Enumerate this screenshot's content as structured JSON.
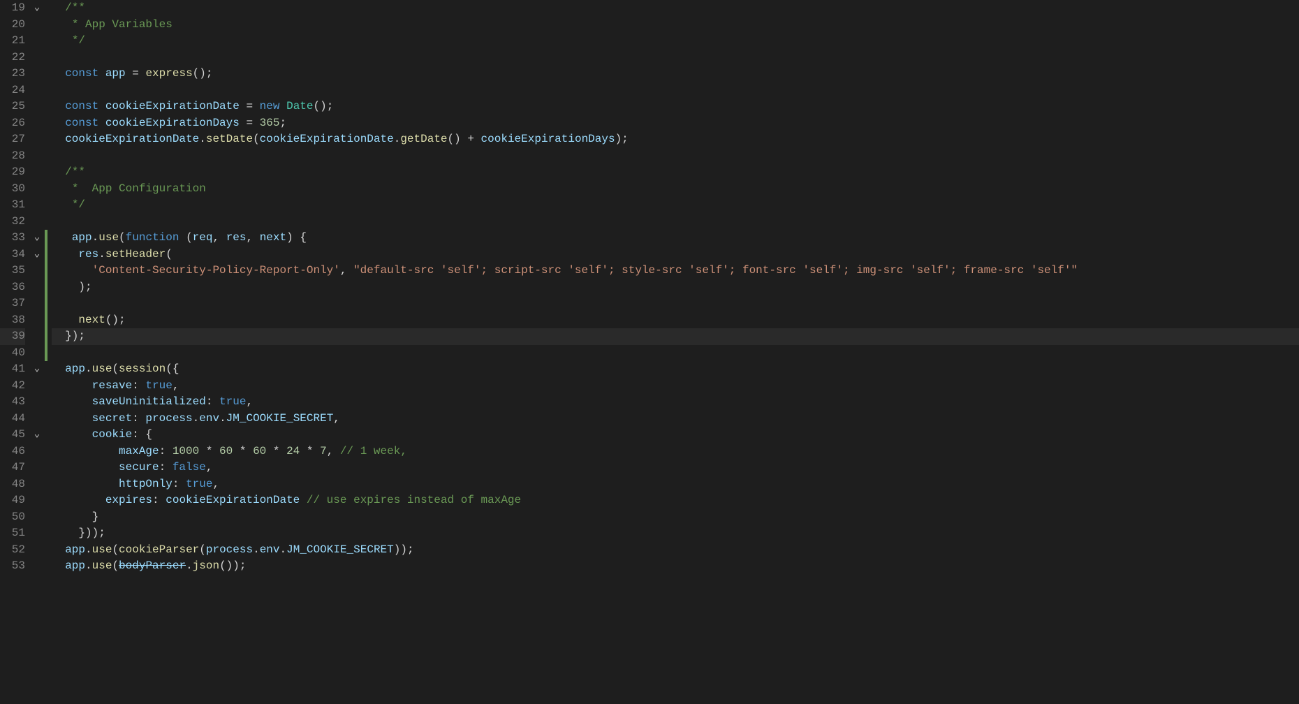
{
  "editor": {
    "startLine": 19,
    "cursorLine": 39,
    "lines": [
      {
        "n": 19,
        "fold": "v",
        "diff": "",
        "tokens": [
          [
            "  ",
            ""
          ],
          [
            "/**",
            "c-comment"
          ]
        ]
      },
      {
        "n": 20,
        "fold": "",
        "diff": "",
        "tokens": [
          [
            "   ",
            ""
          ],
          [
            "* App Variables",
            "c-comment"
          ]
        ]
      },
      {
        "n": 21,
        "fold": "",
        "diff": "",
        "tokens": [
          [
            "   ",
            ""
          ],
          [
            "*/",
            "c-comment"
          ]
        ]
      },
      {
        "n": 22,
        "fold": "",
        "diff": "",
        "tokens": [
          [
            "",
            ""
          ]
        ]
      },
      {
        "n": 23,
        "fold": "",
        "diff": "",
        "tokens": [
          [
            "  ",
            ""
          ],
          [
            "const",
            "c-kw"
          ],
          [
            " ",
            ""
          ],
          [
            "app",
            "c-var"
          ],
          [
            " = ",
            "c-punc"
          ],
          [
            "express",
            "c-fn"
          ],
          [
            "();",
            "c-punc"
          ]
        ]
      },
      {
        "n": 24,
        "fold": "",
        "diff": "",
        "tokens": [
          [
            "",
            ""
          ]
        ]
      },
      {
        "n": 25,
        "fold": "",
        "diff": "",
        "tokens": [
          [
            "  ",
            ""
          ],
          [
            "const",
            "c-kw"
          ],
          [
            " ",
            ""
          ],
          [
            "cookieExpirationDate",
            "c-var"
          ],
          [
            " = ",
            "c-punc"
          ],
          [
            "new",
            "c-kw"
          ],
          [
            " ",
            ""
          ],
          [
            "Date",
            "c-type"
          ],
          [
            "();",
            "c-punc"
          ]
        ]
      },
      {
        "n": 26,
        "fold": "",
        "diff": "",
        "tokens": [
          [
            "  ",
            ""
          ],
          [
            "const",
            "c-kw"
          ],
          [
            " ",
            ""
          ],
          [
            "cookieExpirationDays",
            "c-var"
          ],
          [
            " = ",
            "c-punc"
          ],
          [
            "365",
            "c-num"
          ],
          [
            ";",
            "c-punc"
          ]
        ]
      },
      {
        "n": 27,
        "fold": "",
        "diff": "",
        "tokens": [
          [
            "  ",
            ""
          ],
          [
            "cookieExpirationDate",
            "c-var"
          ],
          [
            ".",
            "c-punc"
          ],
          [
            "setDate",
            "c-fn"
          ],
          [
            "(",
            "c-punc"
          ],
          [
            "cookieExpirationDate",
            "c-var"
          ],
          [
            ".",
            "c-punc"
          ],
          [
            "getDate",
            "c-fn"
          ],
          [
            "() + ",
            "c-punc"
          ],
          [
            "cookieExpirationDays",
            "c-var"
          ],
          [
            ");",
            "c-punc"
          ]
        ]
      },
      {
        "n": 28,
        "fold": "",
        "diff": "",
        "tokens": [
          [
            "",
            ""
          ]
        ]
      },
      {
        "n": 29,
        "fold": "",
        "diff": "",
        "tokens": [
          [
            "  ",
            ""
          ],
          [
            "/**",
            "c-comment"
          ]
        ]
      },
      {
        "n": 30,
        "fold": "",
        "diff": "",
        "tokens": [
          [
            "   ",
            ""
          ],
          [
            "*  App Configuration",
            "c-comment"
          ]
        ]
      },
      {
        "n": 31,
        "fold": "",
        "diff": "",
        "tokens": [
          [
            "   ",
            ""
          ],
          [
            "*/",
            "c-comment"
          ]
        ]
      },
      {
        "n": 32,
        "fold": "",
        "diff": "",
        "tokens": [
          [
            "",
            ""
          ]
        ]
      },
      {
        "n": 33,
        "fold": "v",
        "diff": "mod",
        "tokens": [
          [
            "   ",
            ""
          ],
          [
            "app",
            "c-var"
          ],
          [
            ".",
            "c-punc"
          ],
          [
            "use",
            "c-fn"
          ],
          [
            "(",
            "c-punc"
          ],
          [
            "function",
            "c-kw"
          ],
          [
            " (",
            "c-punc"
          ],
          [
            "req",
            "c-var"
          ],
          [
            ", ",
            "c-punc"
          ],
          [
            "res",
            "c-var"
          ],
          [
            ", ",
            "c-punc"
          ],
          [
            "next",
            "c-var"
          ],
          [
            ") {",
            "c-punc"
          ]
        ]
      },
      {
        "n": 34,
        "fold": "v",
        "diff": "mod",
        "tokens": [
          [
            "    ",
            ""
          ],
          [
            "res",
            "c-var"
          ],
          [
            ".",
            "c-punc"
          ],
          [
            "setHeader",
            "c-fn"
          ],
          [
            "(",
            "c-punc"
          ]
        ]
      },
      {
        "n": 35,
        "fold": "",
        "diff": "mod",
        "tokens": [
          [
            "      ",
            ""
          ],
          [
            "'Content-Security-Policy-Report-Only'",
            "c-str"
          ],
          [
            ", ",
            "c-punc"
          ],
          [
            "\"default-src 'self'; script-src 'self'; style-src 'self'; font-src 'self'; img-src 'self'; frame-src 'self'\"",
            "c-str"
          ]
        ]
      },
      {
        "n": 36,
        "fold": "",
        "diff": "mod",
        "tokens": [
          [
            "    );",
            "c-punc"
          ]
        ]
      },
      {
        "n": 37,
        "fold": "",
        "diff": "mod",
        "tokens": [
          [
            "",
            ""
          ]
        ]
      },
      {
        "n": 38,
        "fold": "",
        "diff": "mod",
        "tokens": [
          [
            "    ",
            ""
          ],
          [
            "next",
            "c-fn"
          ],
          [
            "();",
            "c-punc"
          ]
        ]
      },
      {
        "n": 39,
        "fold": "",
        "diff": "mod",
        "tokens": [
          [
            "  });",
            "c-punc"
          ]
        ]
      },
      {
        "n": 40,
        "fold": "",
        "diff": "mod",
        "tokens": [
          [
            "",
            ""
          ]
        ]
      },
      {
        "n": 41,
        "fold": "v",
        "diff": "",
        "tokens": [
          [
            "  ",
            ""
          ],
          [
            "app",
            "c-var"
          ],
          [
            ".",
            "c-punc"
          ],
          [
            "use",
            "c-fn"
          ],
          [
            "(",
            "c-punc"
          ],
          [
            "session",
            "c-fn"
          ],
          [
            "({",
            "c-punc"
          ]
        ]
      },
      {
        "n": 42,
        "fold": "",
        "diff": "",
        "tokens": [
          [
            "      ",
            ""
          ],
          [
            "resave",
            "c-prop"
          ],
          [
            ": ",
            "c-punc"
          ],
          [
            "true",
            "c-const"
          ],
          [
            ",",
            "c-punc"
          ]
        ]
      },
      {
        "n": 43,
        "fold": "",
        "diff": "",
        "tokens": [
          [
            "      ",
            ""
          ],
          [
            "saveUninitialized",
            "c-prop"
          ],
          [
            ": ",
            "c-punc"
          ],
          [
            "true",
            "c-const"
          ],
          [
            ",",
            "c-punc"
          ]
        ]
      },
      {
        "n": 44,
        "fold": "",
        "diff": "",
        "tokens": [
          [
            "      ",
            ""
          ],
          [
            "secret",
            "c-prop"
          ],
          [
            ": ",
            "c-punc"
          ],
          [
            "process",
            "c-var"
          ],
          [
            ".",
            "c-punc"
          ],
          [
            "env",
            "c-var"
          ],
          [
            ".",
            "c-punc"
          ],
          [
            "JM_COOKIE_SECRET",
            "c-var"
          ],
          [
            ",",
            "c-punc"
          ]
        ]
      },
      {
        "n": 45,
        "fold": "v",
        "diff": "",
        "tokens": [
          [
            "      ",
            ""
          ],
          [
            "cookie",
            "c-prop"
          ],
          [
            ": {",
            "c-punc"
          ]
        ]
      },
      {
        "n": 46,
        "fold": "",
        "diff": "",
        "tokens": [
          [
            "          ",
            ""
          ],
          [
            "maxAge",
            "c-prop"
          ],
          [
            ": ",
            "c-punc"
          ],
          [
            "1000",
            "c-num"
          ],
          [
            " * ",
            "c-punc"
          ],
          [
            "60",
            "c-num"
          ],
          [
            " * ",
            "c-punc"
          ],
          [
            "60",
            "c-num"
          ],
          [
            " * ",
            "c-punc"
          ],
          [
            "24",
            "c-num"
          ],
          [
            " * ",
            "c-punc"
          ],
          [
            "7",
            "c-num"
          ],
          [
            ", ",
            "c-punc"
          ],
          [
            "// 1 week,",
            "c-comment"
          ]
        ]
      },
      {
        "n": 47,
        "fold": "",
        "diff": "",
        "tokens": [
          [
            "          ",
            ""
          ],
          [
            "secure",
            "c-prop"
          ],
          [
            ": ",
            "c-punc"
          ],
          [
            "false",
            "c-const"
          ],
          [
            ",",
            "c-punc"
          ]
        ]
      },
      {
        "n": 48,
        "fold": "",
        "diff": "",
        "tokens": [
          [
            "          ",
            ""
          ],
          [
            "httpOnly",
            "c-prop"
          ],
          [
            ": ",
            "c-punc"
          ],
          [
            "true",
            "c-const"
          ],
          [
            ",",
            "c-punc"
          ]
        ]
      },
      {
        "n": 49,
        "fold": "",
        "diff": "",
        "tokens": [
          [
            "        ",
            ""
          ],
          [
            "expires",
            "c-prop"
          ],
          [
            ": ",
            "c-punc"
          ],
          [
            "cookieExpirationDate",
            "c-var"
          ],
          [
            " ",
            ""
          ],
          [
            "// use expires instead of maxAge",
            "c-comment"
          ]
        ]
      },
      {
        "n": 50,
        "fold": "",
        "diff": "",
        "tokens": [
          [
            "      }",
            "c-punc"
          ]
        ]
      },
      {
        "n": 51,
        "fold": "",
        "diff": "",
        "tokens": [
          [
            "    }));",
            "c-punc"
          ]
        ]
      },
      {
        "n": 52,
        "fold": "",
        "diff": "",
        "tokens": [
          [
            "  ",
            ""
          ],
          [
            "app",
            "c-var"
          ],
          [
            ".",
            "c-punc"
          ],
          [
            "use",
            "c-fn"
          ],
          [
            "(",
            "c-punc"
          ],
          [
            "cookieParser",
            "c-fn"
          ],
          [
            "(",
            "c-punc"
          ],
          [
            "process",
            "c-var"
          ],
          [
            ".",
            "c-punc"
          ],
          [
            "env",
            "c-var"
          ],
          [
            ".",
            "c-punc"
          ],
          [
            "JM_COOKIE_SECRET",
            "c-var"
          ],
          [
            "));",
            "c-punc"
          ]
        ]
      },
      {
        "n": 53,
        "fold": "",
        "diff": "",
        "tokens": [
          [
            "  ",
            ""
          ],
          [
            "app",
            "c-var"
          ],
          [
            ".",
            "c-punc"
          ],
          [
            "use",
            "c-fn"
          ],
          [
            "(",
            "c-punc"
          ],
          [
            "bodyParser",
            "c-var strike"
          ],
          [
            ".",
            "c-punc"
          ],
          [
            "json",
            "c-fn"
          ],
          [
            "());",
            "c-punc"
          ]
        ]
      }
    ]
  }
}
